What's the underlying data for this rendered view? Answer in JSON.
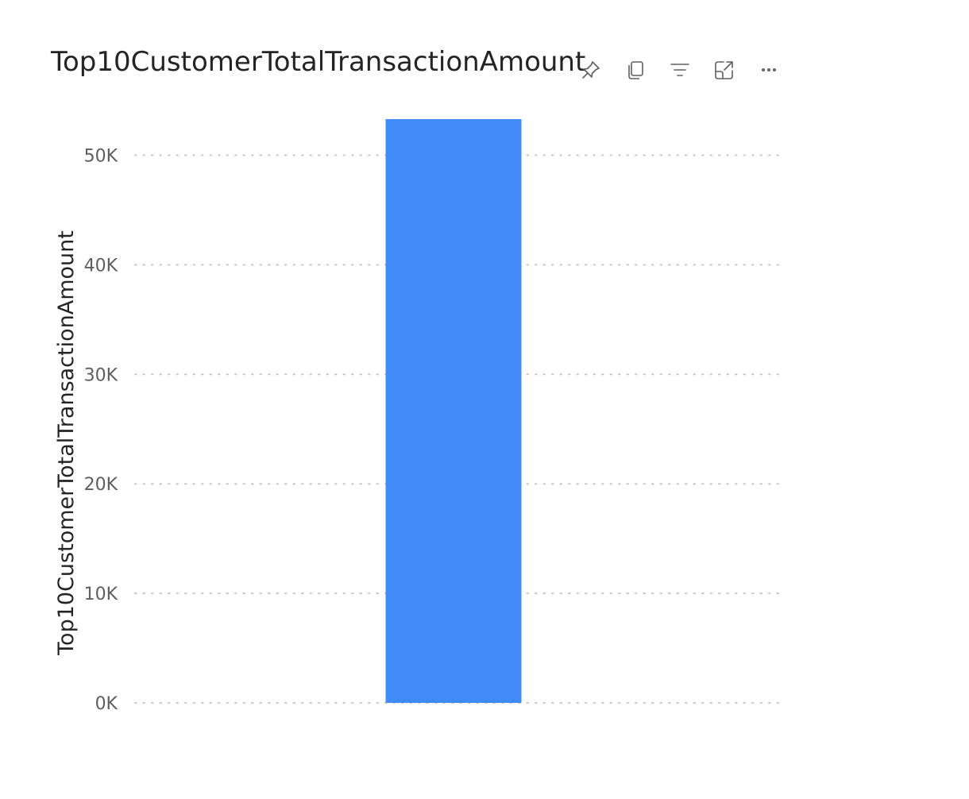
{
  "header": {
    "icons": [
      "pin-icon",
      "copy-icon",
      "filter-icon",
      "focus-mode-icon",
      "more-options-icon"
    ]
  },
  "chart_data": {
    "type": "bar",
    "title": "Top10CustomerTotalTransactionAmount",
    "xlabel": "",
    "ylabel": "Top10CustomerTotalTransactionAmount",
    "categories": [
      ""
    ],
    "values": [
      53300
    ],
    "ylim": [
      0,
      53300
    ],
    "yticks": [
      0,
      10000,
      20000,
      30000,
      40000,
      50000
    ],
    "ytick_labels": [
      "0K",
      "10K",
      "20K",
      "30K",
      "40K",
      "50K"
    ],
    "grid": true,
    "legend": "none",
    "colors": {
      "bar": "#418bf9",
      "grid": "#c8c6c4",
      "text": "#252423",
      "tick": "#605e5c"
    }
  }
}
